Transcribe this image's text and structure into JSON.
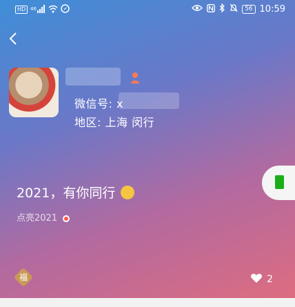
{
  "status_bar": {
    "left_badge": "HD",
    "signal": "⁴⁶ᐩıl",
    "wifi": "wifi",
    "battery": "56",
    "time": "10:59"
  },
  "profile": {
    "wechat_id_label": "微信号: x",
    "region_label": "地区: 上海  闵行"
  },
  "status": {
    "text": "2021，有你同行",
    "tag": "点亮2021"
  },
  "likes": {
    "count": "2"
  },
  "fu_char": "福"
}
